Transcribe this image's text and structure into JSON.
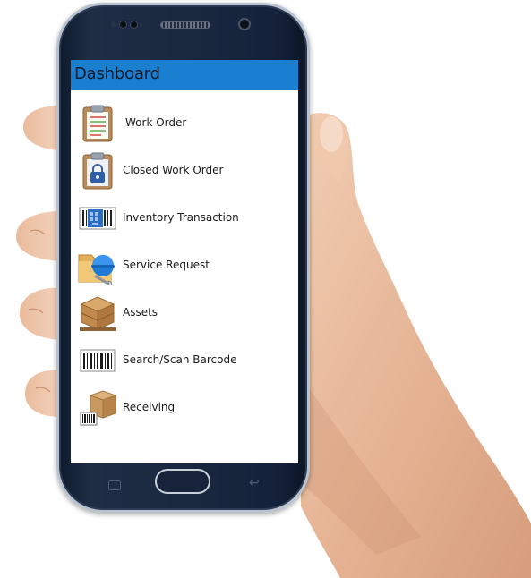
{
  "app": {
    "title": "Dashboard",
    "accent_color": "#1a7fd0"
  },
  "menu": {
    "items": [
      {
        "label": "Work Order",
        "icon": "clipboard-icon"
      },
      {
        "label": "Closed Work Order",
        "icon": "locked-clipboard-icon"
      },
      {
        "label": "Inventory Transaction",
        "icon": "inventory-barcode-icon"
      },
      {
        "label": "Service Request",
        "icon": "service-folder-icon"
      },
      {
        "label": "Assets",
        "icon": "crate-pallet-icon"
      },
      {
        "label": "Search/Scan Barcode",
        "icon": "barcode-icon"
      },
      {
        "label": "Receiving",
        "icon": "receiving-box-icon"
      }
    ]
  },
  "device": {
    "nav": {
      "recent_icon": "recent-apps-icon",
      "home_icon": "home-button",
      "back_icon": "back-icon"
    }
  }
}
